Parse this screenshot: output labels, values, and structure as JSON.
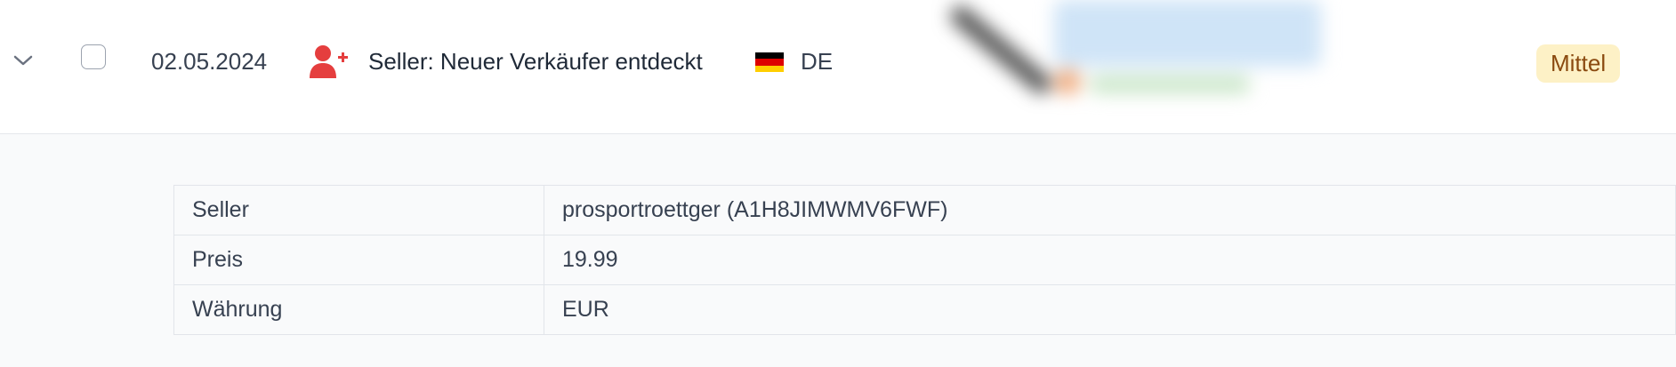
{
  "row": {
    "date": "02.05.2024",
    "title": "Seller: Neuer Verkäufer entdeckt",
    "country": "DE",
    "priority": "Mittel",
    "icons": {
      "expand": "chevron-down-icon",
      "event": "user-plus-icon",
      "flag": "germany-flag-icon"
    },
    "colors": {
      "event_icon": "#e53e3e",
      "badge_bg": "#fdf1c6",
      "badge_text": "#8a4a10"
    }
  },
  "details": {
    "rows": [
      {
        "key": "Seller",
        "value": "prosportroettger (A1H8JIMWMV6FWF)"
      },
      {
        "key": "Preis",
        "value": "19.99"
      },
      {
        "key": "Währung",
        "value": "EUR"
      }
    ]
  }
}
